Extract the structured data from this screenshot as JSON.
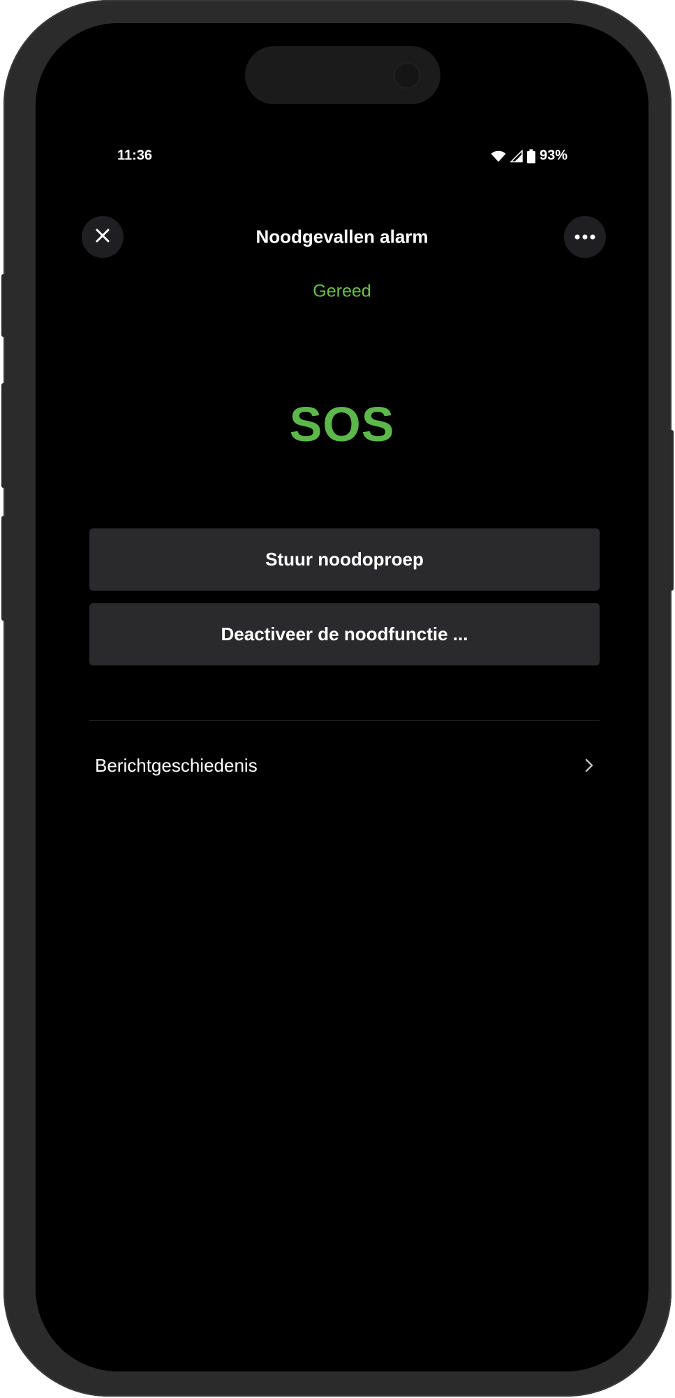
{
  "status_bar": {
    "time": "11:36",
    "battery_percent": "93%",
    "icons": [
      "wifi-icon",
      "signal-icon",
      "battery-icon"
    ]
  },
  "header": {
    "title": "Noodgevallen alarm",
    "close_icon": "close-icon",
    "more_icon": "more-icon"
  },
  "status": {
    "label": "Gereed",
    "color": "#6cc04a"
  },
  "sos": {
    "label": "SOS",
    "color": "#5cb84a"
  },
  "actions": {
    "send_label": "Stuur noodoproep",
    "deactivate_label": "Deactiveer de noodfunctie ..."
  },
  "history": {
    "label": "Berichtgeschiedenis",
    "chevron_icon": "chevron-right-icon"
  },
  "colors": {
    "background": "#000000",
    "button": "#2a2a2c",
    "accent_green": "#5cb84a"
  }
}
